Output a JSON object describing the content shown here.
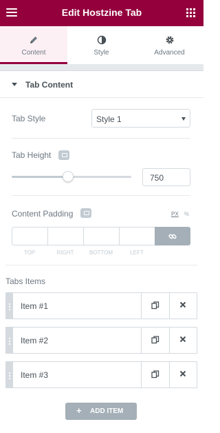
{
  "header": {
    "title": "Edit Hostzine Tab",
    "menu_icon": "hamburger-icon",
    "apps_icon": "grid-icon"
  },
  "tabs": [
    {
      "label": "Content",
      "icon": "pencil-icon",
      "active": true
    },
    {
      "label": "Style",
      "icon": "half-circle-icon",
      "active": false
    },
    {
      "label": "Advanced",
      "icon": "gear-icon",
      "active": false
    }
  ],
  "section": {
    "title": "Tab Content"
  },
  "controls": {
    "tab_style": {
      "label": "Tab Style",
      "value": "Style 1"
    },
    "tab_height": {
      "label": "Tab Height",
      "value": "750",
      "slider_fraction": 0.47
    },
    "content_padding": {
      "label": "Content Padding",
      "unit_px": "PX",
      "unit_pct": "%",
      "dimension_labels": [
        "TOP",
        "RIGHT",
        "BOTTOM",
        "LEFT"
      ]
    }
  },
  "repeater": {
    "label": "Tabs Items",
    "items": [
      {
        "title": "Item #1"
      },
      {
        "title": "Item #2"
      },
      {
        "title": "Item #3"
      }
    ],
    "add_label": "ADD ITEM",
    "add_icon": "+"
  },
  "colors": {
    "brand": "#93003c",
    "muted": "#a4afb7",
    "border": "#d5dadf"
  }
}
